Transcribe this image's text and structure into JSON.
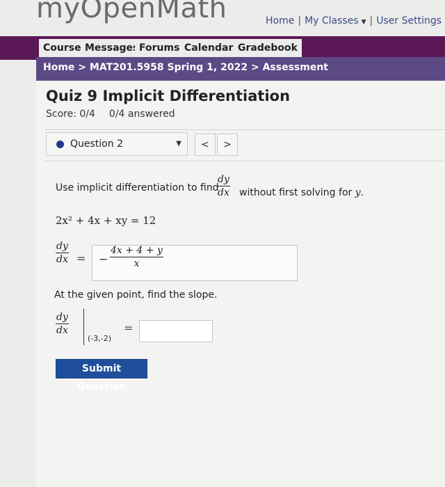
{
  "app": {
    "logo": "myOpenMath"
  },
  "toplinks": {
    "home": "Home",
    "my_classes": "My Classes",
    "user_settings": "User Settings",
    "sep": "|"
  },
  "nav": {
    "tabs": [
      "Course",
      "Messages",
      "Forums",
      "Calendar",
      "Gradebook"
    ]
  },
  "breadcrumb": {
    "home": "Home",
    "course": "MAT201.5958 Spring 1, 2022",
    "current": "Assessment",
    "sep": ">"
  },
  "quiz": {
    "title": "Quiz 9 Implicit Differentiation",
    "score": "Score: 0/4",
    "answered": "0/4 answered"
  },
  "question_nav": {
    "selected": "Question 2",
    "prev": "<",
    "next": ">"
  },
  "question": {
    "prompt_before": "Use implicit differentiation to find",
    "prompt_after": "without first solving for",
    "prompt_var": "y",
    "prompt_end": ".",
    "dy": "dy",
    "dx": "dx",
    "equation": "2x² + 4x + xy = 12",
    "answer_numerator": "4x + 4 + y",
    "answer_denominator": "x",
    "answer_sign": "−",
    "equals": "=",
    "prompt2": "At the given point, find the slope.",
    "point": "(-3,-2)",
    "slope_value": ""
  },
  "actions": {
    "submit": "Submit Question"
  },
  "colors": {
    "nav_bg": "#5b1856",
    "breadcrumb_bg": "#5b4a86",
    "submit_bg": "#1f4f9c",
    "link": "#3a4a8a"
  }
}
